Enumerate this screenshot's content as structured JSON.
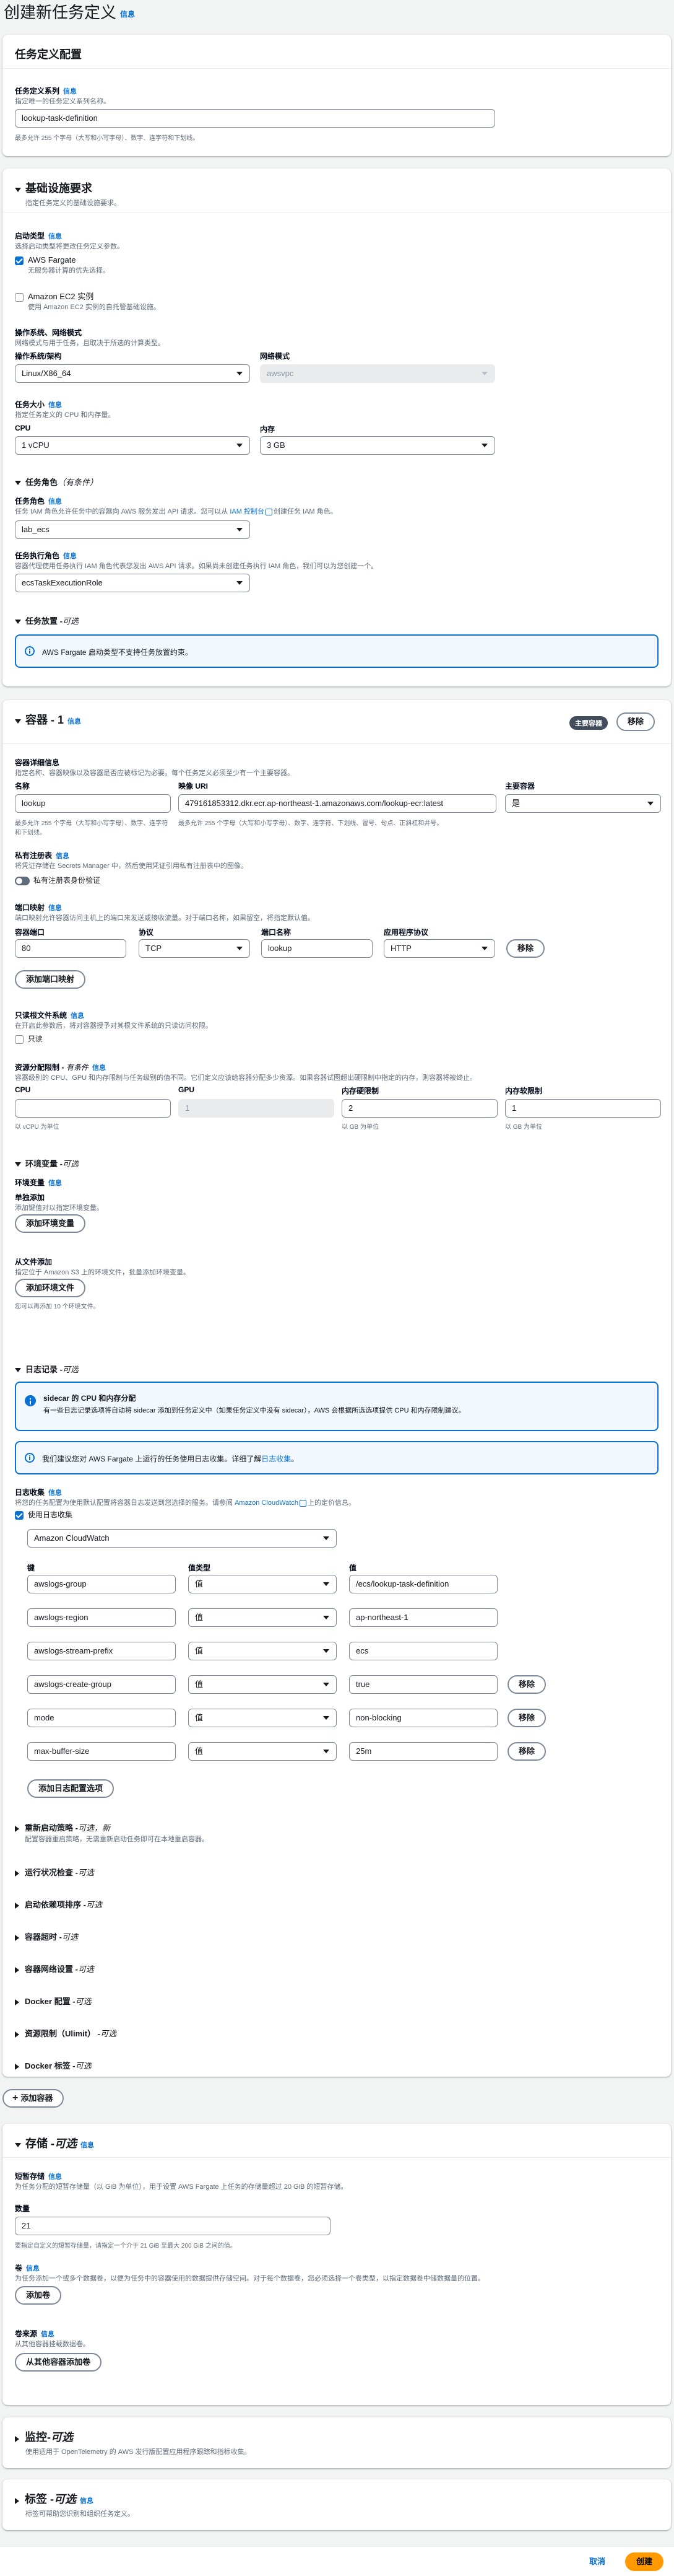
{
  "page": {
    "title": "创建新任务定义",
    "info": "信息"
  },
  "task_config": {
    "title": "任务定义配置",
    "family_label": "任务定义系列",
    "family_desc": "指定唯一的任务定义系列名称。",
    "family_value": "lookup-task-definition",
    "family_hint": "最多允许 255 个字母（大写和小写字母）、数字、连字符和下划线。"
  },
  "infra": {
    "title": "基础设施要求",
    "subtitle": "指定任务定义的基础设施要求。",
    "launch_type_label": "启动类型",
    "launch_type_desc": "选择启动类型将更改任务定义参数。",
    "fargate_label": "AWS Fargate",
    "fargate_desc": "无服务器计算的优先选择。",
    "ec2_label": "Amazon EC2 实例",
    "ec2_desc": "使用 Amazon EC2 实例的自托管基础设施。",
    "os_group_label": "操作系统、网络模式",
    "os_group_desc": "网络模式与用于任务，且取决于所选的计算类型。",
    "os_label": "操作系统/架构",
    "os_value": "Linux/X86_64",
    "network_label": "网络模式",
    "network_value": "awsvpc",
    "size_label": "任务大小",
    "size_desc": "指定任务定义的 CPU 和内存量。",
    "cpu_label": "CPU",
    "cpu_value": "1 vCPU",
    "memory_label": "内存",
    "memory_value": "3 GB",
    "roles_label": "任务角色",
    "roles_optional": "（有条件）",
    "task_role_label": "任务角色",
    "task_role_desc_1": "任务 IAM 角色允许任务中的容器向 AWS 服务发出 API 请求。您可以从",
    "task_role_link": "IAM 控制台",
    "task_role_desc_2": "创建任务 IAM 角色。",
    "task_role_value": "lab_ecs",
    "exec_role_label": "任务执行角色",
    "exec_role_desc": "容器代理使用任务执行 IAM 角色代表您发出 AWS API 请求。如果尚未创建任务执行 IAM 角色，我们可以为您创建一个。",
    "exec_role_value": "ecsTaskExecutionRole",
    "placement_label": "任务放置 -",
    "placement_optional": "可选",
    "fargate_alert": "AWS Fargate 启动类型不支持任务放置约束。"
  },
  "container": {
    "title": "容器 - 1",
    "badge": "主要容器",
    "remove": "移除",
    "details_label": "容器详细信息",
    "details_desc": "指定名称、容器映像以及容器是否应被标记为必要。每个任务定义必须至少有一个主要容器。",
    "name_label": "名称",
    "name_value": "lookup",
    "name_hint": "最多允许 255 个字母（大写和小写字母）、数字、连字符和下划线。",
    "image_label": "映像 URI",
    "image_value": "479161853312.dkr.ecr.ap-northeast-1.amazonaws.com/lookup-ecr:latest",
    "image_hint": "最多允许 255 个字母（大写和小写字母）、数字、连字符、下划线、冒号、句点、正斜杠和井号。",
    "essential_label": "主要容器",
    "essential_value": "是",
    "private_label": "私有注册表",
    "private_desc": "将凭证存储在 Secrets Manager 中，然后使用凭证引用私有注册表中的图像。",
    "private_toggle": "私有注册表身份验证",
    "ports_label": "端口映射",
    "ports_desc": "端口映射允许容器访问主机上的端口来发送或接收流量。对于端口名称，如果留空，将指定默认值。",
    "port_col": "容器端口",
    "protocol_col": "协议",
    "port_name_col": "端口名称",
    "app_protocol_col": "应用程序协议",
    "port_value": "80",
    "protocol_value": "TCP",
    "port_name_value": "lookup",
    "app_protocol_value": "HTTP",
    "port_remove": "移除",
    "add_port": "添加端口映射",
    "readonly_label": "只读根文件系统",
    "readonly_desc": "在开启此参数后，将对容器授予对其根文件系统的只读访问权限。",
    "readonly_checkbox": "只读",
    "resource_label": "资源分配限制 -",
    "resource_optional": "有条件",
    "resource_desc": "容器级别的 CPU、GPU 和内存限制与任务级别的值不同。它们定义应该给容器分配多少资源。如果容器试图超出硬限制中指定的内存，则容器将被终止。",
    "cpu_label": "CPU",
    "cpu_value": "",
    "cpu_hint": "以 vCPU 为单位",
    "gpu_label": "GPU",
    "gpu_value": "1",
    "mem_hard_label": "内存硬限制",
    "mem_hard_value": "2",
    "mem_hard_hint": "以 GB 为单位",
    "mem_soft_label": "内存软限制",
    "mem_soft_value": "1",
    "mem_soft_hint": "以 GB 为单位",
    "env_label": "环境变量 -",
    "env_optional": "可选",
    "env_vars_label": "环境变量",
    "single_add_label": "单独添加",
    "single_add_desc": "添加键值对以指定环境变量。",
    "add_env_button": "添加环境变量",
    "file_add_label": "从文件添加",
    "file_add_desc": "指定位于 Amazon S3 上的环境文件，批量添加环境变量。",
    "add_env_file_button": "添加环境文件",
    "file_add_hint": "您可以再添加 10 个环境文件。",
    "log_label": "日志记录 -",
    "log_optional": "可选",
    "sidecar_title": "sidecar 的 CPU 和内存分配",
    "sidecar_desc": "有一些日志记录选项将自动将 sidecar 添加到任务定义中（如果任务定义中没有 sidecar），AWS 会根据所选选项提供 CPU 和内存限制建议。",
    "fargate_log_text": "我们建议您对 AWS Fargate 上运行的任务使用日志收集。详细了解",
    "fargate_log_link": "日志收集",
    "log_collect_label": "日志收集",
    "log_collect_desc_1": "将您的任务配置为使用默认配置将容器日志发送到您选择的服务。请参阅",
    "log_collect_link": "Amazon CloudWatch",
    "log_collect_desc_2": "上的定价信息。",
    "use_log_label": "使用日志收集",
    "log_driver_value": "Amazon CloudWatch",
    "key_col": "键",
    "value_type_col": "值类型",
    "value_col": "值",
    "log_options": [
      {
        "key": "awslogs-group",
        "type": "值",
        "value": "/ecs/lookup-task-definition",
        "removable": false
      },
      {
        "key": "awslogs-region",
        "type": "值",
        "value": "ap-northeast-1",
        "removable": false
      },
      {
        "key": "awslogs-stream-prefix",
        "type": "值",
        "value": "ecs",
        "removable": false
      },
      {
        "key": "awslogs-create-group",
        "type": "值",
        "value": "true",
        "removable": true
      },
      {
        "key": "mode",
        "type": "值",
        "value": "non-blocking",
        "removable": true
      },
      {
        "key": "max-buffer-size",
        "type": "值",
        "value": "25m",
        "removable": true
      }
    ],
    "log_remove": "移除",
    "add_log_option": "添加日志配置选项",
    "restart_label": "重新启动策略 -",
    "restart_optional": "可选，新",
    "restart_desc": "配置容器重启策略，无需重新启动任务即可在本地重启容器。",
    "collapsed": [
      {
        "title": "运行状况检查 -",
        "opt": "可选"
      },
      {
        "title": "启动依赖项排序 -",
        "opt": "可选"
      },
      {
        "title": "容器超时 -",
        "opt": "可选"
      },
      {
        "title": "容器网络设置 -",
        "opt": "可选"
      },
      {
        "title": "Docker 配置 -",
        "opt": "可选"
      },
      {
        "title": "资源限制（Ulimit） -",
        "opt": "可选"
      },
      {
        "title": "Docker 标签 -",
        "opt": "可选"
      }
    ]
  },
  "add_container": "添加容器",
  "storage": {
    "title": "存储 -",
    "optional": "可选",
    "ephemeral_label": "短暂存储",
    "ephemeral_desc": "为任务分配的短暂存储量（以 GiB 为单位），用于设置 AWS Fargate 上任务的存储量超过 20 GiB 的短暂存储。",
    "amount_label": "数量",
    "amount_value": "21",
    "amount_hint": "要指定自定义的短暂存储量，请指定一个介于 21 GiB 至最大 200 GiB 之间的值。",
    "volumes_label": "卷",
    "volumes_desc": "为任务添加一个或多个数据卷，以便为任务中的容器使用的数据提供存储空间。对于每个数据卷，您必须选择一个卷类型，以指定数据卷中储数据量的位置。",
    "add_volume": "添加卷",
    "volumes_from_label": "卷来源",
    "volumes_from_desc": "从其他容器挂载数据卷。",
    "add_volumes_from": "从其他容器添加卷"
  },
  "monitoring": {
    "title": "监控-",
    "optional": "可选",
    "desc": "使用适用于 OpenTelemetry 的 AWS 发行版配置应用程序跟踪和指标收集。"
  },
  "tags": {
    "title": "标签 -",
    "optional": "可选",
    "desc": "标签可帮助您识别和组织任务定义。"
  },
  "footer": {
    "cancel": "取消",
    "create": "创建"
  }
}
